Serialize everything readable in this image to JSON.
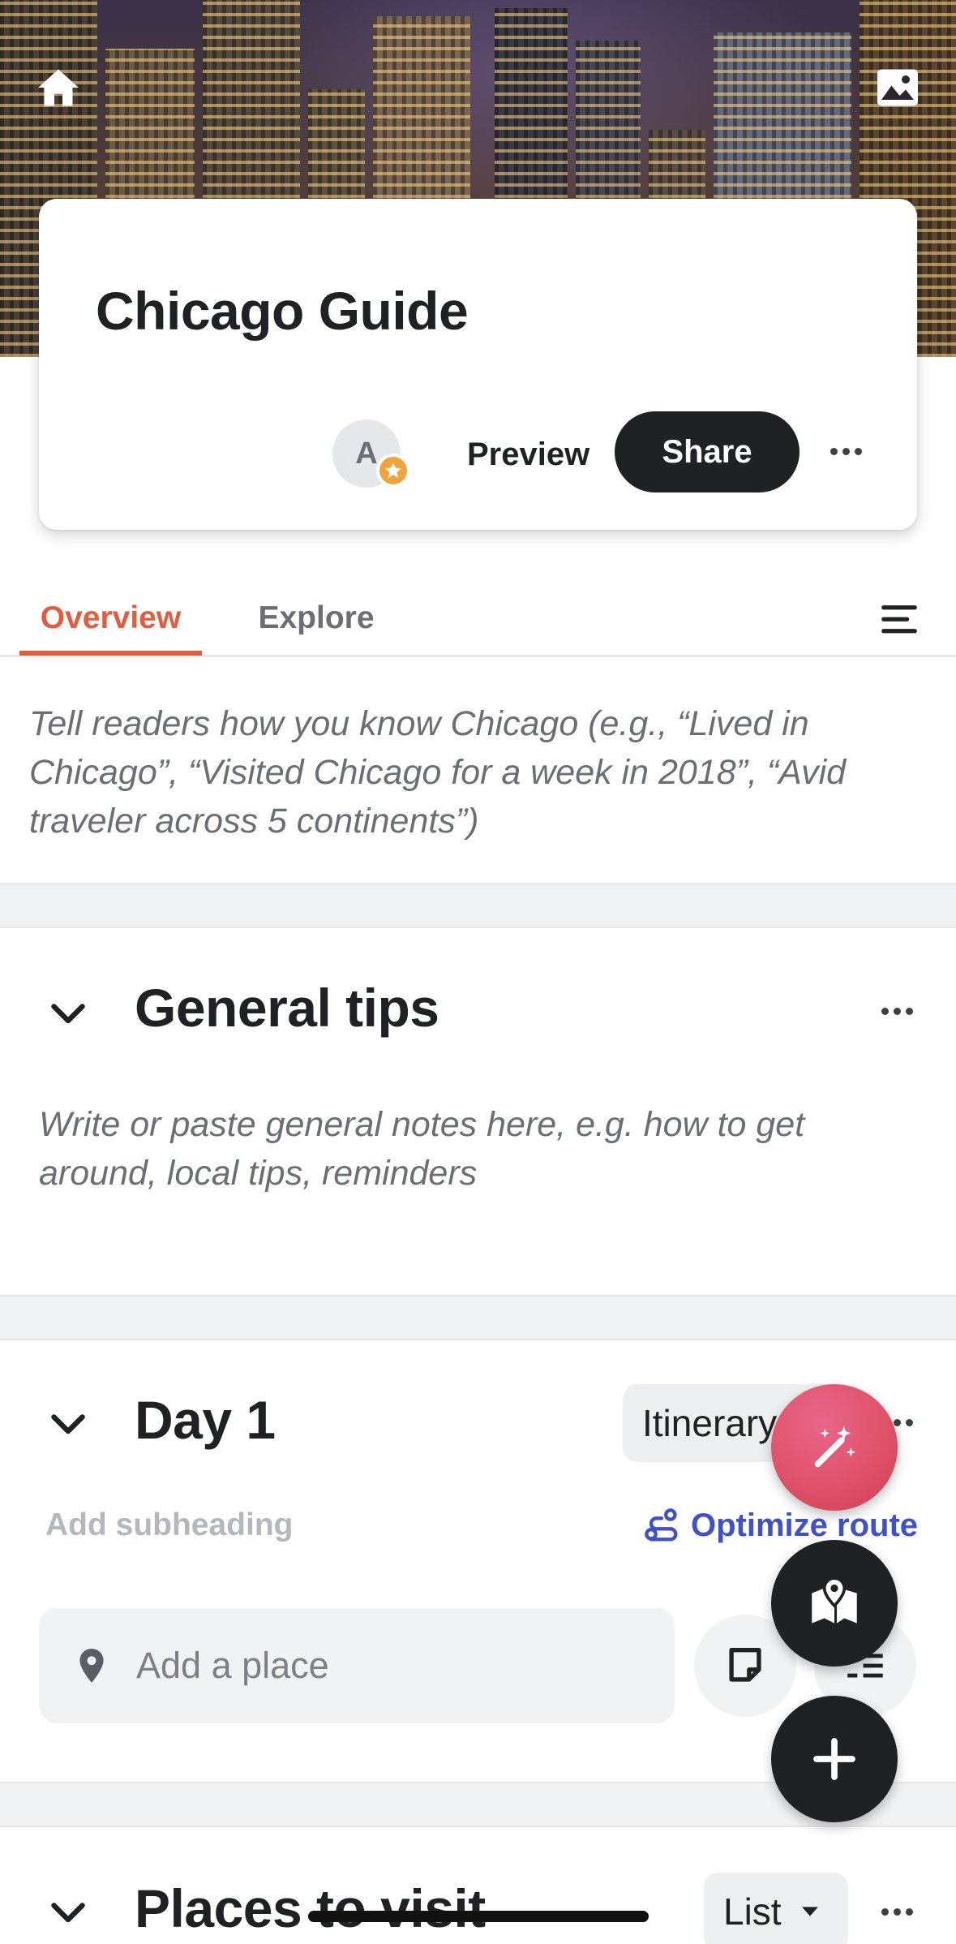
{
  "guide": {
    "title": "Chicago Guide",
    "avatar_initial": "A",
    "preview_label": "Preview",
    "share_label": "Share"
  },
  "hero": {
    "home_icon": "home-icon",
    "change_cover_icon": "image-icon"
  },
  "tabs": [
    {
      "label": "Overview",
      "active": true
    },
    {
      "label": "Explore",
      "active": false
    }
  ],
  "intro": {
    "placeholder": "Tell readers how you know Chicago (e.g., “Lived in Chicago”, “Visited Chicago for a week in 2018”, “Avid traveler across 5 continents”)"
  },
  "general_tips": {
    "title": "General tips",
    "notes_placeholder": "Write or paste general notes here, e.g. how to get around, local tips, reminders"
  },
  "day1": {
    "title": "Day 1",
    "view_mode": "Itinerary",
    "subheading_placeholder": "Add subheading",
    "optimize_label": "Optimize route",
    "add_place_placeholder": "Add a place"
  },
  "places": {
    "title": "Places to visit",
    "view_mode": "List"
  },
  "colors": {
    "accent": "#e45c3f",
    "link": "#3f51c9",
    "dark": "#1f2124",
    "magic_fab": "#e0526a"
  }
}
